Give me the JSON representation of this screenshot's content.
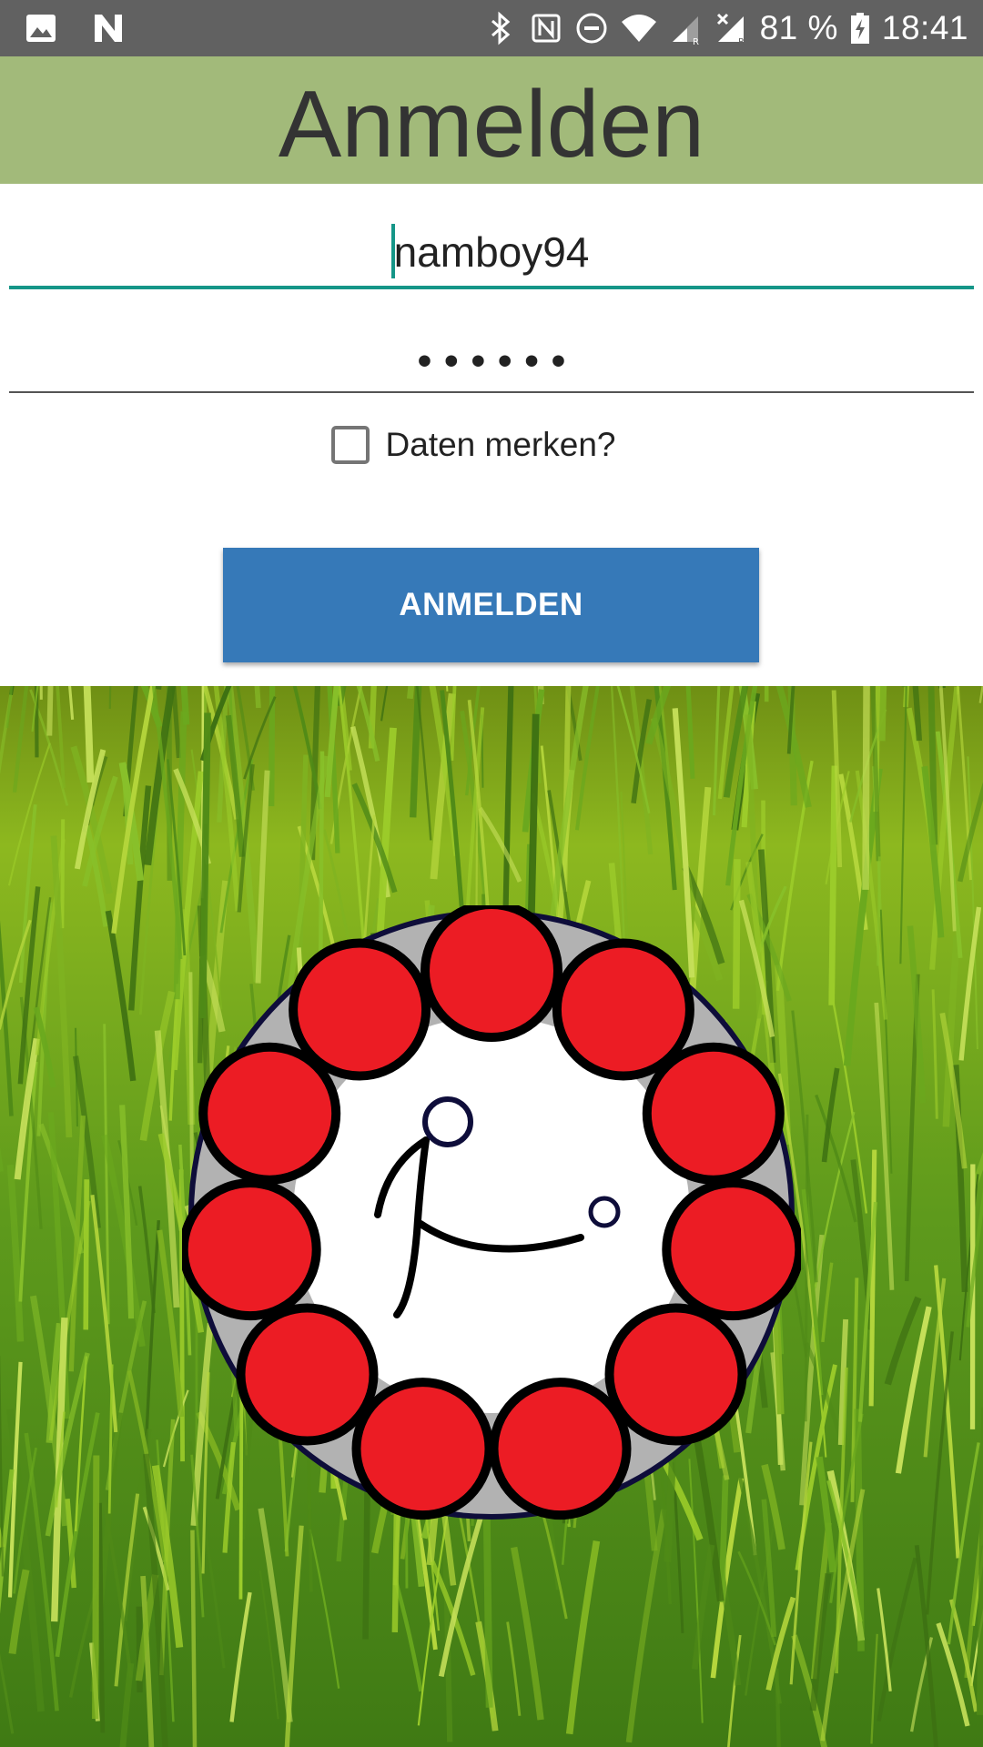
{
  "status_bar": {
    "battery": "81 %",
    "time": "18:41"
  },
  "header": {
    "title": "Anmelden"
  },
  "form": {
    "username": "namboy94",
    "password_mask": "••••••",
    "remember_label": "Daten merken?",
    "remember_checked": false,
    "login_button": "ANMELDEN"
  },
  "colors": {
    "header_bg": "#a2ba7a",
    "accent": "#159688",
    "button_bg": "#3679b8",
    "logo_red": "#ec1c24"
  }
}
